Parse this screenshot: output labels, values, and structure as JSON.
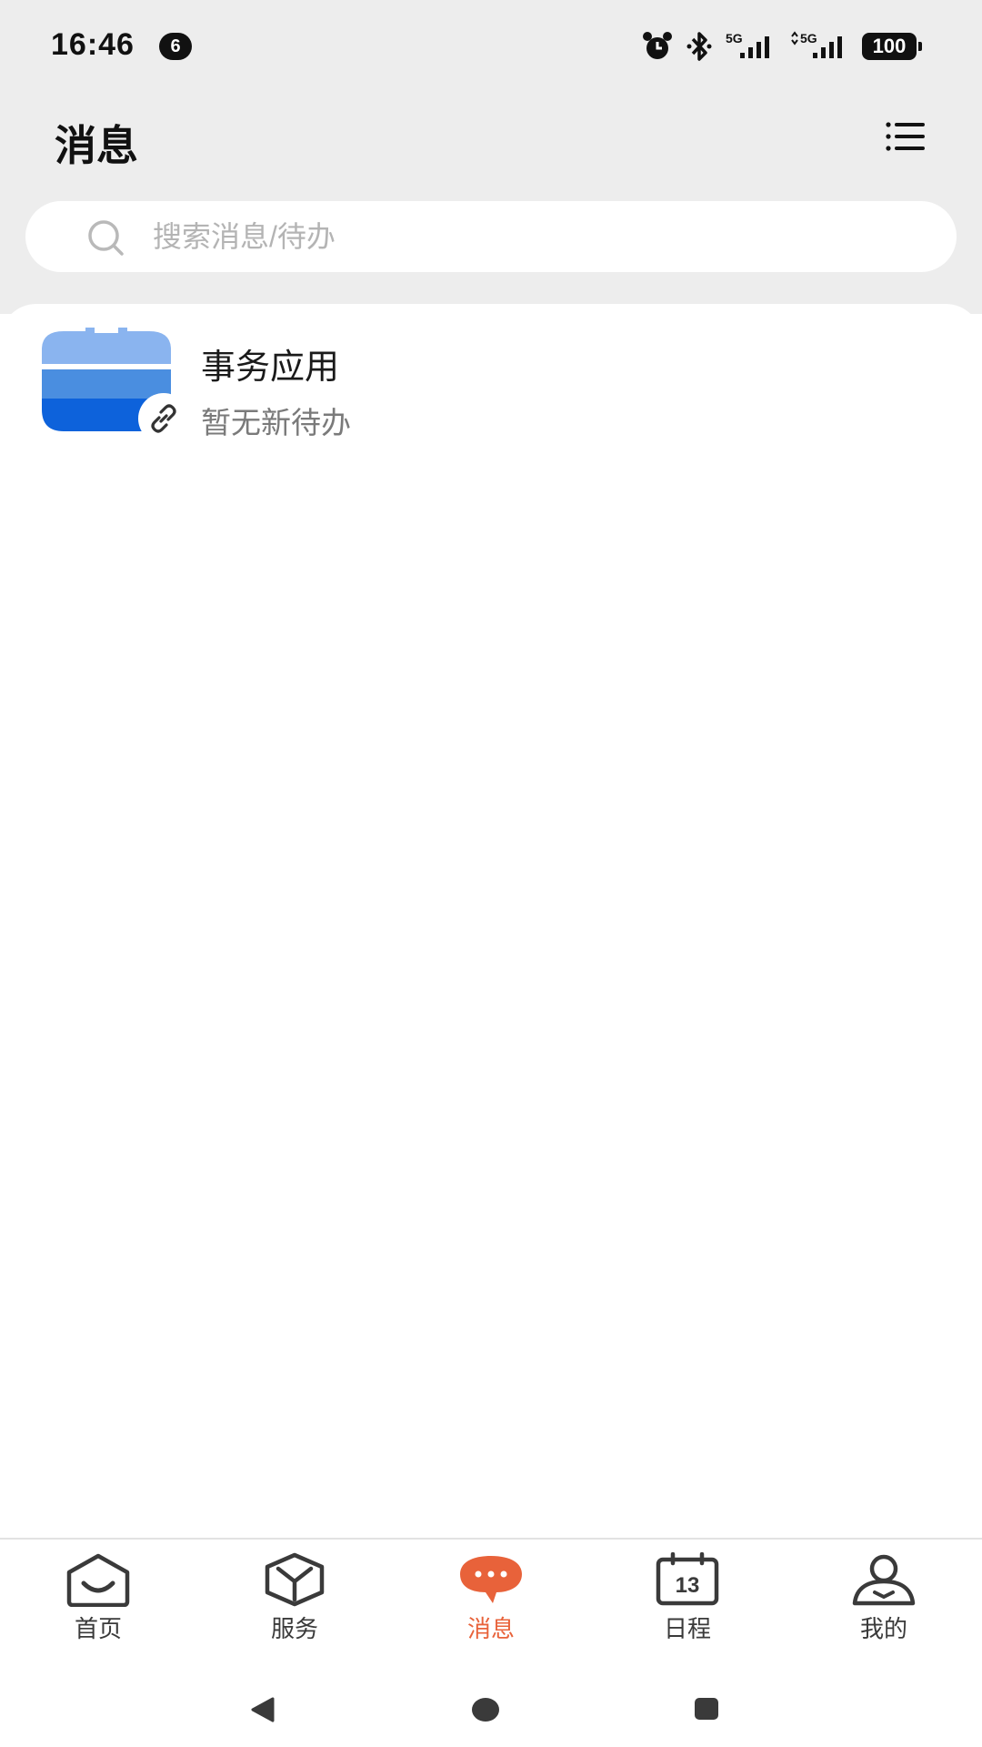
{
  "status_bar": {
    "time": "16:46",
    "notification_count": "6",
    "icons": [
      "alarm-icon",
      "bluetooth-icon",
      "5g-signal-icon",
      "5g-signal-icon"
    ],
    "network_1": "5G",
    "network_2": "5G",
    "battery": "100"
  },
  "header": {
    "title": "消息",
    "menu_icon": "list-menu-icon"
  },
  "search": {
    "placeholder": "搜索消息/待办",
    "value": ""
  },
  "messages": [
    {
      "title": "事务应用",
      "subtitle": "暂无新待办",
      "avatar_icon": "app-logo-icon",
      "badge_icon": "link-icon"
    }
  ],
  "tabs": [
    {
      "label": "首页",
      "icon": "home-icon",
      "active": false
    },
    {
      "label": "服务",
      "icon": "box-icon",
      "active": false
    },
    {
      "label": "消息",
      "icon": "chat-bubble-icon",
      "active": true
    },
    {
      "label": "日程",
      "icon": "calendar-icon",
      "active": false,
      "icon_text": "13"
    },
    {
      "label": "我的",
      "icon": "person-icon",
      "active": false
    }
  ],
  "colors": {
    "accent": "#e8623a",
    "background_top": "#ededed",
    "avatar_light": "#8ab4ef",
    "avatar_mid": "#4a8ee0",
    "avatar_dark": "#0d62db"
  },
  "nav_bar": [
    "back-icon",
    "home-circle-icon",
    "recents-icon"
  ]
}
